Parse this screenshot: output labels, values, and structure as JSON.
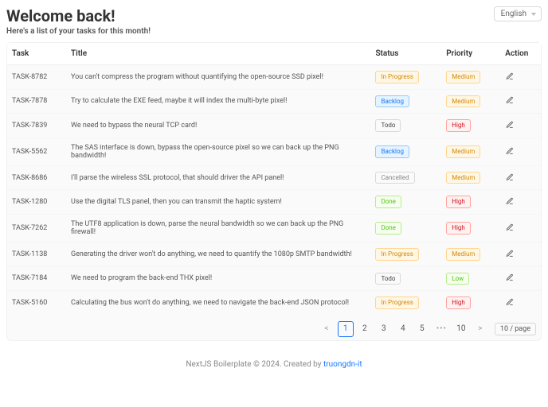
{
  "header": {
    "title": "Welcome back!",
    "subtitle": "Here's a list of your tasks for this month!",
    "language": "English"
  },
  "columns": {
    "task": "Task",
    "title": "Title",
    "status": "Status",
    "priority": "Priority",
    "action": "Action"
  },
  "status_labels": {
    "in_progress": "In Progress",
    "backlog": "Backlog",
    "todo": "Todo",
    "cancelled": "Cancelled",
    "done": "Done"
  },
  "priority_labels": {
    "medium": "Medium",
    "high": "High",
    "low": "Low"
  },
  "tasks": [
    {
      "id": "TASK-8782",
      "title": "You can't compress the program without quantifying the open-source SSD pixel!",
      "status": "in_progress",
      "priority": "medium"
    },
    {
      "id": "TASK-7878",
      "title": "Try to calculate the EXE feed, maybe it will index the multi-byte pixel!",
      "status": "backlog",
      "priority": "medium"
    },
    {
      "id": "TASK-7839",
      "title": "We need to bypass the neural TCP card!",
      "status": "todo",
      "priority": "high"
    },
    {
      "id": "TASK-5562",
      "title": "The SAS interface is down, bypass the open-source pixel so we can back up the PNG bandwidth!",
      "status": "backlog",
      "priority": "medium"
    },
    {
      "id": "TASK-8686",
      "title": "I'll parse the wireless SSL protocol, that should driver the API panel!",
      "status": "cancelled",
      "priority": "medium"
    },
    {
      "id": "TASK-1280",
      "title": "Use the digital TLS panel, then you can transmit the haptic system!",
      "status": "done",
      "priority": "high"
    },
    {
      "id": "TASK-7262",
      "title": "The UTF8 application is down, parse the neural bandwidth so we can back up the PNG firewall!",
      "status": "done",
      "priority": "high"
    },
    {
      "id": "TASK-1138",
      "title": "Generating the driver won't do anything, we need to quantify the 1080p SMTP bandwidth!",
      "status": "in_progress",
      "priority": "medium"
    },
    {
      "id": "TASK-7184",
      "title": "We need to program the back-end THX pixel!",
      "status": "todo",
      "priority": "low"
    },
    {
      "id": "TASK-5160",
      "title": "Calculating the bus won't do anything, we need to navigate the back-end JSON protocol!",
      "status": "in_progress",
      "priority": "high"
    }
  ],
  "pagination": {
    "pages": [
      "1",
      "2",
      "3",
      "4",
      "5"
    ],
    "ellipsis": "•••",
    "last": "10",
    "page_size": "10 / page",
    "prev": "<",
    "next": ">"
  },
  "footer": {
    "text": "NextJS Boilerplate © 2024. Created by ",
    "author": "truongdn-it"
  }
}
